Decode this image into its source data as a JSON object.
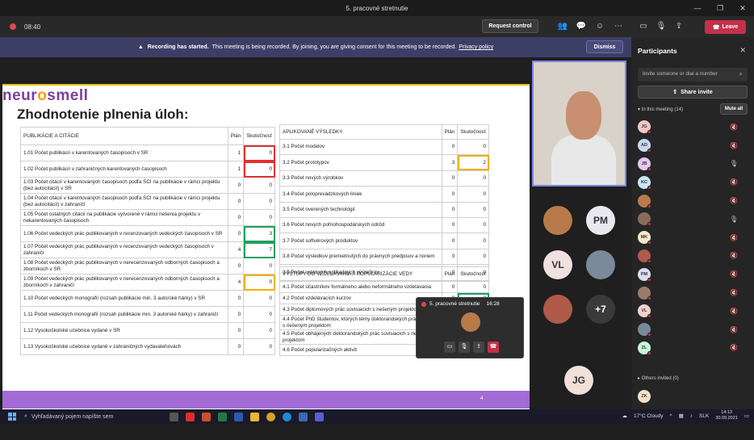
{
  "window": {
    "title": "5. pracovné stretnutie"
  },
  "meeting": {
    "timer": "08:40",
    "request_control": "Request control",
    "leave": "Leave"
  },
  "banner": {
    "bold": "Recording has started.",
    "text": "This meeting is being recorded. By joining, you are giving consent for this meeting to be recorded.",
    "link": "Privacy policy",
    "dismiss": "Dismiss"
  },
  "slide": {
    "logo_a": "neur",
    "logo_o": "o",
    "logo_b": "smell",
    "title": "Zhodnotenie plnenia úloh:",
    "left_table": {
      "header": [
        "PUBLIKÁCIE A CITÁCIE",
        "Plán",
        "Skutočnosť"
      ],
      "rows": [
        [
          "1.01 Počet publikácií v karentovaných časopisoch v SR",
          "1",
          "0"
        ],
        [
          "1.02 Počet publikácií v zahraničných karentovaných časopisoch",
          "1",
          "0"
        ],
        [
          "1.03  Počet citácií v karentovaných časopisoch podľa SCI na publikácie v rámci projektu (bez autocitácií) v SR",
          "0",
          "0"
        ],
        [
          "1.04 Počet citácií v karentovaných časopisoch podľa SCI na publikácie v rámci projektu (bez autocitácií) v zahraničí",
          "0",
          "0"
        ],
        [
          "1.05 Počet ostatných citácií na publikácie vytvorené v rámci riešenia projektu v nekarentovaných časopisoch",
          "0",
          "0"
        ],
        [
          "1.06 Počet vedeckých prác publikovaných v recenzovaných vedeckých časopisoch v SR",
          "0",
          "3"
        ],
        [
          "1.07 Počet vedeckých prác publikovaných v recenzovaných vedeckých časopisoch v zahraničí",
          "4",
          "7"
        ],
        [
          "1.08 Počet vedeckých prác publikovaných v nerecenzovaných odborných časopisoch a zborníkoch v SR",
          "0",
          "0"
        ],
        [
          "1.09 Počet vedeckých prác publikovaných v nerecenzovaných odborných časopisoch a zborníkoch v zahraničí",
          "4",
          "0"
        ],
        [
          "1.10 Počet vedeckých monografií (rozsah publikácie min. 3 autorské hárky) v SR",
          "0",
          "0"
        ],
        [
          "1.11 Počet vedeckých monografií (rozsah publikácie min. 3 autorské hárky) v zahraničí",
          "0",
          "0"
        ],
        [
          "1.12 Vysokoškolské učebnice vydané v SR",
          "0",
          "0"
        ],
        [
          "1.13 Vysokoškolské učebnice vydané v zahraničných vydavateľstvách",
          "0",
          "0"
        ]
      ]
    },
    "right_table1": {
      "header": [
        "APLIKOVANÉ VÝSLEDKY",
        "Plán",
        "Skutočnosť"
      ],
      "rows": [
        [
          "3.1  Počet modelov",
          "0",
          "0"
        ],
        [
          "3.2  Počet prototypov",
          "3",
          "2"
        ],
        [
          "3.3  Počet nových výrobkov",
          "0",
          "0"
        ],
        [
          "3.4  Počet poloprevádzkových liniek",
          "0",
          "0"
        ],
        [
          "3.5  Počet overených technológií",
          "0",
          "0"
        ],
        [
          "3.6  Počet nových poľnohospodárskych odrôd",
          "0",
          "0"
        ],
        [
          "3.7  Počet softvérových produktov",
          "0",
          "0"
        ],
        [
          "3.8  Počet výsledkov premietnutých do právnych predpisov a noriem",
          "0",
          "0"
        ],
        [
          "3.9  Počet ostatných aplikačných výsledkov",
          "0",
          "0"
        ]
      ]
    },
    "right_table2": {
      "header": [
        "VÝSTUPY DO VZDELÁVANIA A POPULARIZÁCIE VEDY",
        "Plán",
        "Skutočnosť"
      ],
      "rows": [
        [
          "4.1  Počet účastníkov formálneho alebo neformálneho vzdelávania",
          "0",
          "0"
        ],
        [
          "4.2  Počet vzdelávacích kurzov",
          "0",
          "3"
        ],
        [
          "4.3  Počet diplomových prác súvisiacich s riešeným projektom",
          "",
          ""
        ],
        [
          "4.4  Počet PhD študentov, ktorých témy doktorandských prác súvisia s riešeným projektom",
          "",
          ""
        ],
        [
          "4.5  Počet obhájených doktorandských prác súvisiacich s riešeným projektom",
          "",
          ""
        ],
        [
          "4.6  Počet popularizačných aktivít",
          "",
          ""
        ]
      ]
    },
    "page_number": "4"
  },
  "popout": {
    "title": "5. pracovné stretnutie",
    "time": "16:28"
  },
  "tiles": [
    {
      "initials": "PM",
      "bg": "#e8e8f0",
      "fg": "#333"
    },
    {
      "initials": "VL",
      "bg": "#f0e0e0",
      "fg": "#333"
    },
    {
      "initials": "+7",
      "bg": "#3a3a3a",
      "fg": "#fff"
    },
    {
      "initials": "JG",
      "bg": "#f0e0d8",
      "fg": "#333"
    }
  ],
  "panel": {
    "title": "Participants",
    "invite_placeholder": "Invite someone or dial a number",
    "share_invite": "Share invite",
    "in_meeting": "In this meeting (14)",
    "mute_all": "Mute all",
    "others_invited": "Others invited (0)",
    "participants": [
      {
        "initials": "JG",
        "color": "#f4c7c7",
        "mic": "off"
      },
      {
        "initials": "AD",
        "color": "#c7daf4",
        "mic": "off"
      },
      {
        "initials": "JB",
        "color": "#e7c7f4",
        "mic": "on"
      },
      {
        "initials": "KC",
        "color": "#c7e7f4",
        "mic": "off"
      },
      {
        "initials": "",
        "color": "#b87a4b",
        "mic": "off"
      },
      {
        "initials": "",
        "color": "#8a6a5a",
        "mic": "on"
      },
      {
        "initials": "MK",
        "color": "#f4e7c7",
        "mic": "off"
      },
      {
        "initials": "",
        "color": "#b05a4a",
        "mic": "off"
      },
      {
        "initials": "PM",
        "color": "#dcdcf4",
        "mic": "off"
      },
      {
        "initials": "",
        "color": "#9a7a6a",
        "mic": "off"
      },
      {
        "initials": "VL",
        "color": "#f4d0d0",
        "mic": "off"
      },
      {
        "initials": "",
        "color": "#7a8a9a",
        "mic": "off"
      },
      {
        "initials": "ZL",
        "color": "#c7f4d6",
        "mic": "off"
      }
    ],
    "invited": [
      {
        "initials": "ZK",
        "color": "#f4e0c7"
      }
    ]
  },
  "taskbar": {
    "search": "Vyhľadávaný pojem napíšte sem",
    "weather": "17°C  Cloudy",
    "lang": "SLK",
    "time": "14:13",
    "date": "30.09.2021"
  }
}
